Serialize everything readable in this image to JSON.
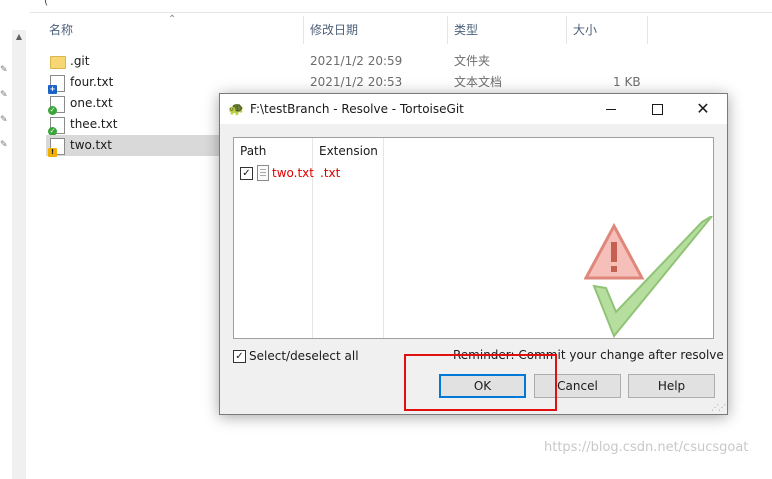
{
  "explorer": {
    "crumb": "(",
    "columns": {
      "name": "名称",
      "modified": "修改日期",
      "type": "类型",
      "size": "大小"
    },
    "files": [
      {
        "name": ".git",
        "modified": "2021/1/2 20:59",
        "type": "文件夹",
        "size": "",
        "icon": "folder-icon",
        "overlay": ""
      },
      {
        "name": "four.txt",
        "modified": "2021/1/2 20:53",
        "type": "文本文档",
        "size": "1 KB",
        "icon": "text-file-icon",
        "overlay": "added"
      },
      {
        "name": "one.txt",
        "modified": "",
        "type": "",
        "size": "",
        "icon": "text-file-icon",
        "overlay": "normal"
      },
      {
        "name": "thee.txt",
        "modified": "",
        "type": "",
        "size": "",
        "icon": "text-file-icon",
        "overlay": "normal"
      },
      {
        "name": "two.txt",
        "modified": "",
        "type": "",
        "size": "",
        "icon": "text-file-icon",
        "overlay": "conflict",
        "selected": true
      }
    ]
  },
  "dialog": {
    "title": "F:\\testBranch - Resolve - TortoiseGit",
    "list": {
      "columns": {
        "path": "Path",
        "extension": "Extension"
      },
      "rows": [
        {
          "checked": true,
          "path": "two.txt",
          "extension": ".txt",
          "color": "#e00000"
        }
      ]
    },
    "select_all": {
      "label": "Select/deselect all",
      "checked": true
    },
    "reminder": "Reminder: Commit your change after resolve",
    "buttons": {
      "ok": "OK",
      "cancel": "Cancel",
      "help": "Help"
    }
  },
  "watermark": "https://blog.csdn.net/csucsgoat"
}
